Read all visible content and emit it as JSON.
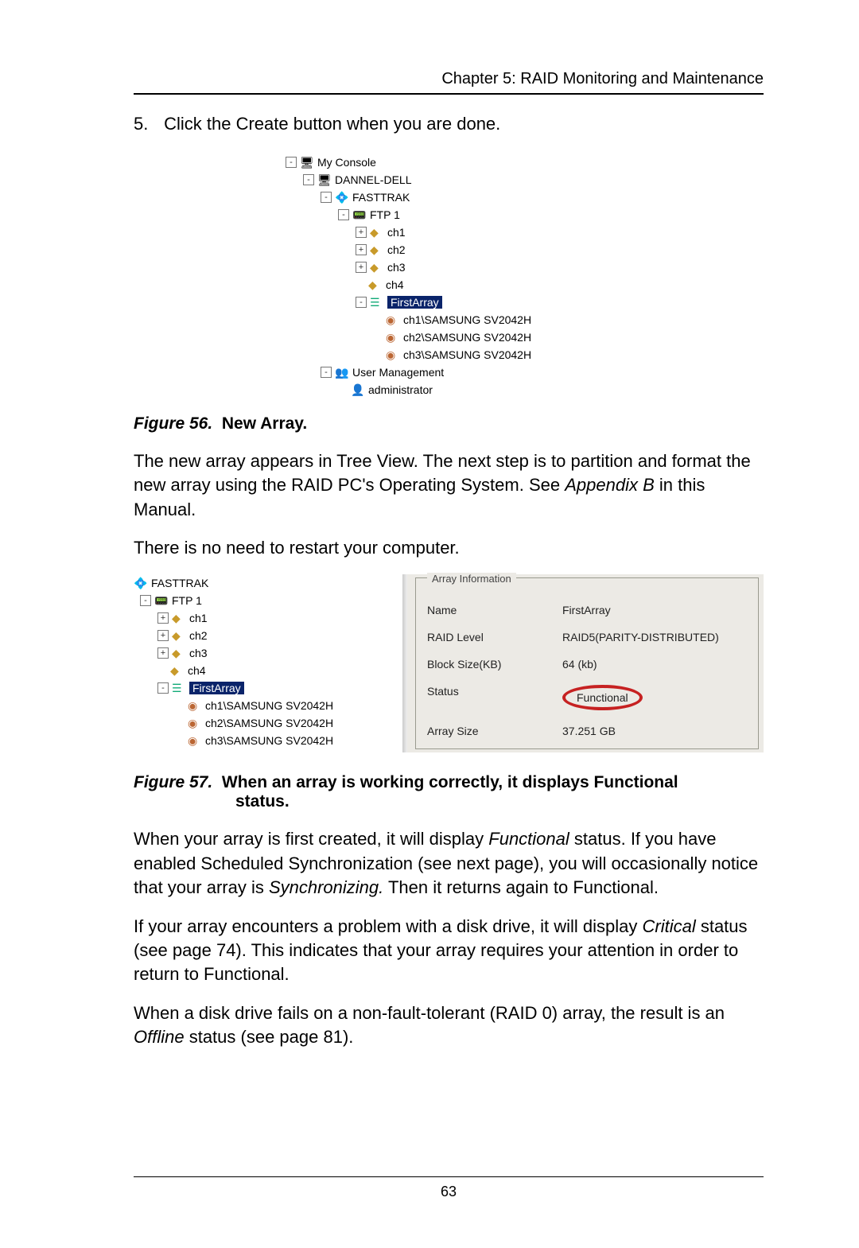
{
  "header": {
    "chapter": "Chapter 5: RAID Monitoring and Maintenance"
  },
  "step": {
    "num": "5.",
    "text": "Click the Create button when you are done."
  },
  "tree1": {
    "myconsole": "My Console",
    "host": "DANNEL-DELL",
    "card": "FASTTRAK",
    "ftp": "FTP 1",
    "ch1": "ch1",
    "ch2": "ch2",
    "ch3": "ch3",
    "ch4": "ch4",
    "array": "FirstArray",
    "d1": "ch1\\SAMSUNG SV2042H",
    "d2": "ch2\\SAMSUNG SV2042H",
    "d3": "ch3\\SAMSUNG SV2042H",
    "usermgmt": "User Management",
    "admin": "administrator"
  },
  "fig56": {
    "label": "Figure 56.",
    "title": "New Array."
  },
  "para1": {
    "a": "The new array appears in Tree View. The next step is to partition and format the new array using the RAID PC's Operating System. See ",
    "b": "Appendix B",
    "c": " in this Manual."
  },
  "para2": "There is no need to restart your computer.",
  "tree2": {
    "card": "FASTTRAK",
    "ftp": "FTP 1",
    "ch1": "ch1",
    "ch2": "ch2",
    "ch3": "ch3",
    "ch4": "ch4",
    "array": "FirstArray",
    "d1": "ch1\\SAMSUNG SV2042H",
    "d2": "ch2\\SAMSUNG SV2042H",
    "d3": "ch3\\SAMSUNG SV2042H"
  },
  "info": {
    "legend": "Array Information",
    "name_l": "Name",
    "name_v": "FirstArray",
    "raid_l": "RAID Level",
    "raid_v": "RAID5(PARITY-DISTRIBUTED)",
    "blk_l": "Block Size(KB)",
    "blk_v": "64 (kb)",
    "stat_l": "Status",
    "stat_v": "Functional",
    "size_l": "Array Size",
    "size_v": "37.251 GB"
  },
  "fig57": {
    "label": "Figure 57.",
    "title_a": "When an array is working correctly, it displays Functional",
    "title_b": "status."
  },
  "para3": {
    "a": "When your array is first created, it will display ",
    "b": "Functional",
    "c": " status. If you have enabled Scheduled Synchronization (see next page), you will occasionally notice that your array is ",
    "d": "Synchronizing.",
    "e": " Then it returns again to Functional."
  },
  "para4": {
    "a": "If your array encounters a problem with a disk drive, it will display ",
    "b": "Critical",
    "c": " status (see page 74). This indicates that your array requires your attention in order to return to Functional."
  },
  "para5": {
    "a": "When a disk drive fails on a non-fault-tolerant (RAID 0) array, the result is an ",
    "b": "Offline",
    "c": " status (see page 81)."
  },
  "footer": {
    "page": "63"
  }
}
